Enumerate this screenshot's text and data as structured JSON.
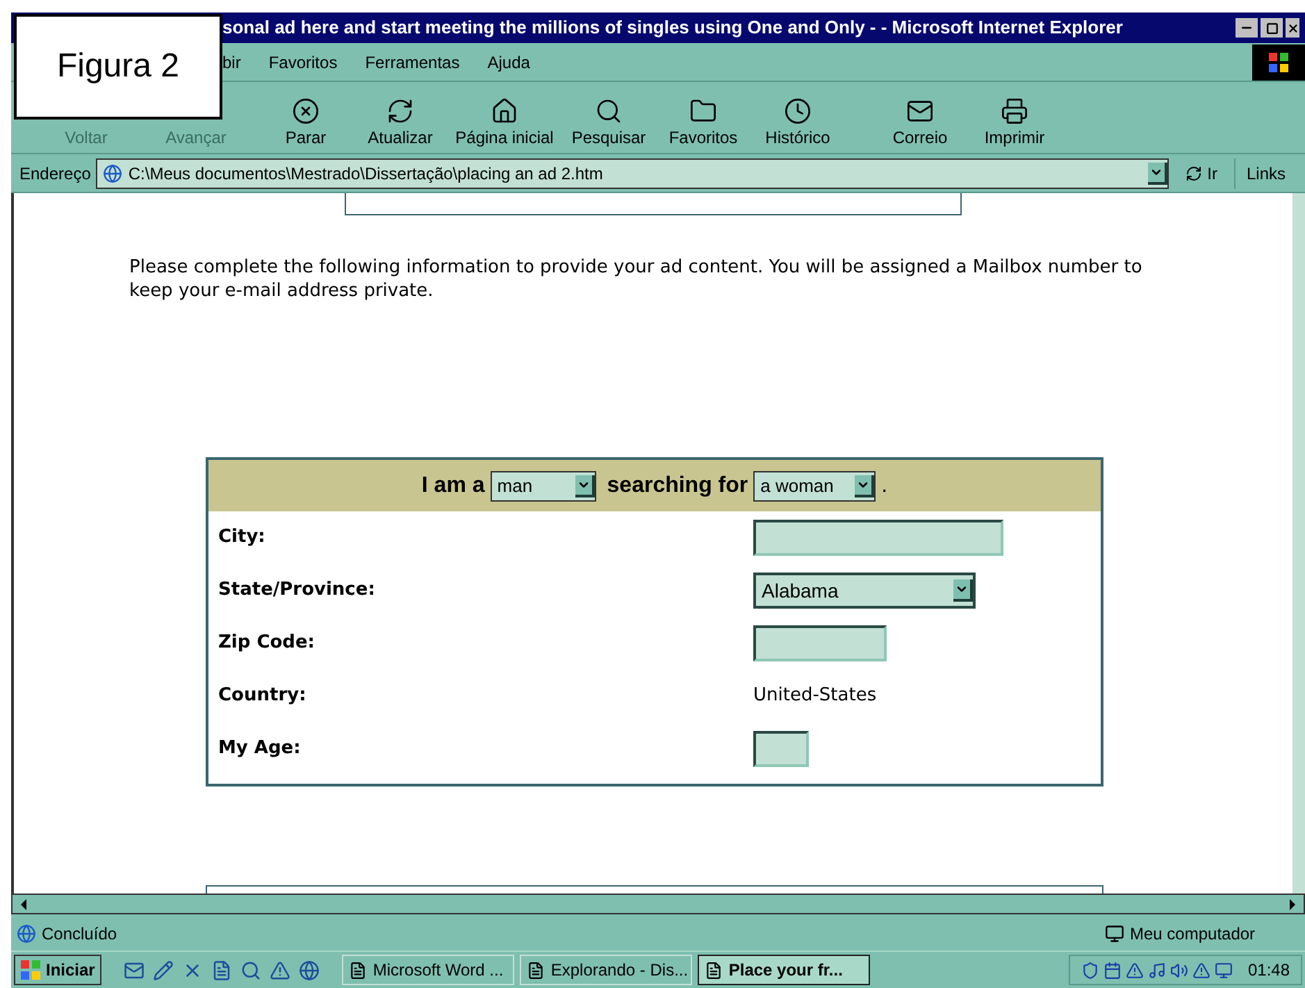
{
  "window": {
    "title": "sonal ad here and start meeting the millions of singles using One and Only - - Microsoft Internet Explorer"
  },
  "overlay_label": "Figura 2",
  "menu": [
    "bir",
    "Favoritos",
    "Ferramentas",
    "Ajuda"
  ],
  "toolbar": [
    {
      "label": "Voltar",
      "disabled": true
    },
    {
      "label": "Avançar",
      "disabled": true
    },
    {
      "label": "Parar",
      "disabled": false
    },
    {
      "label": "Atualizar",
      "disabled": false
    },
    {
      "label": "Página inicial",
      "disabled": false
    },
    {
      "label": "Pesquisar",
      "disabled": false
    },
    {
      "label": "Favoritos",
      "disabled": false
    },
    {
      "label": "Histórico",
      "disabled": false
    },
    {
      "label": "Correio",
      "disabled": false
    },
    {
      "label": "Imprimir",
      "disabled": false
    }
  ],
  "address": {
    "label": "Endereço",
    "value": "C:\\Meus documentos\\Mestrado\\Dissertação\\placing an ad 2.htm",
    "go": "Ir",
    "links": "Links"
  },
  "page": {
    "intro": "Please complete the following information to provide your ad content. You will be assigned a Mailbox number to keep your e-mail address private.",
    "form": {
      "header": {
        "prefix": "I am a",
        "gender": "man",
        "middle": "searching for",
        "seeking": "a woman",
        "end": "."
      },
      "rows": [
        {
          "label": "City:",
          "kind": "text"
        },
        {
          "label": "State/Province:",
          "kind": "select",
          "value": "Alabama"
        },
        {
          "label": "Zip Code:",
          "kind": "text"
        },
        {
          "label": "Country:",
          "kind": "static",
          "value": "United-States"
        },
        {
          "label": "My Age:",
          "kind": "text"
        }
      ]
    }
  },
  "status_bar": {
    "text": "Concluído",
    "zone": "Meu computador"
  },
  "taskbar": {
    "start": "Iniciar",
    "tasks": [
      {
        "label": "Microsoft Word ...",
        "selected": false
      },
      {
        "label": "Explorando - Dis...",
        "selected": false
      },
      {
        "label": "Place your fr...",
        "selected": true
      }
    ],
    "clock": "01:48"
  }
}
